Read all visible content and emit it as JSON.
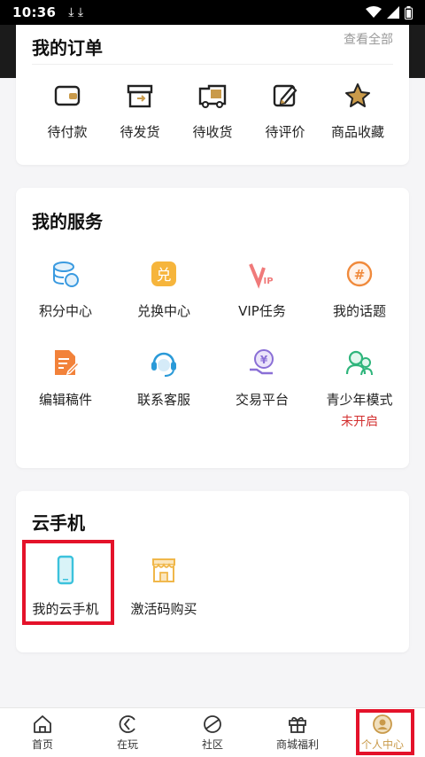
{
  "status_bar": {
    "time": "10:36",
    "download_icons": "⤓ ⤓"
  },
  "orders": {
    "title": "我的订单",
    "view_all": "查看全部",
    "items": [
      {
        "label": "待付款",
        "icon": "wallet-icon"
      },
      {
        "label": "待发货",
        "icon": "box-icon"
      },
      {
        "label": "待收货",
        "icon": "truck-icon"
      },
      {
        "label": "待评价",
        "icon": "edit-icon"
      },
      {
        "label": "商品收藏",
        "icon": "star-icon"
      }
    ]
  },
  "services": {
    "title": "我的服务",
    "items": [
      {
        "label": "积分中心",
        "icon": "coins-icon"
      },
      {
        "label": "兑换中心",
        "icon": "exchange-icon"
      },
      {
        "label": "VIP任务",
        "icon": "vip-icon"
      },
      {
        "label": "我的话题",
        "icon": "hashtag-icon"
      },
      {
        "label": "编辑稿件",
        "icon": "document-edit-icon"
      },
      {
        "label": "联系客服",
        "icon": "headset-icon"
      },
      {
        "label": "交易平台",
        "icon": "trade-icon"
      },
      {
        "label": "青少年模式",
        "icon": "teen-icon",
        "status": "未开启"
      }
    ]
  },
  "cloud_phone": {
    "title": "云手机",
    "items": [
      {
        "label": "我的云手机",
        "icon": "phone-icon"
      },
      {
        "label": "激活码购买",
        "icon": "shop-icon"
      }
    ]
  },
  "bottom_nav": [
    {
      "label": "首页",
      "icon": "home-icon"
    },
    {
      "label": "在玩",
      "icon": "play-icon"
    },
    {
      "label": "社区",
      "icon": "community-icon"
    },
    {
      "label": "商城福利",
      "icon": "gift-icon"
    },
    {
      "label": "个人中心",
      "icon": "profile-icon",
      "active": true
    }
  ],
  "colors": {
    "accent": "#c99a4a",
    "highlight": "#e4122a",
    "status_red": "#d32f2f"
  }
}
